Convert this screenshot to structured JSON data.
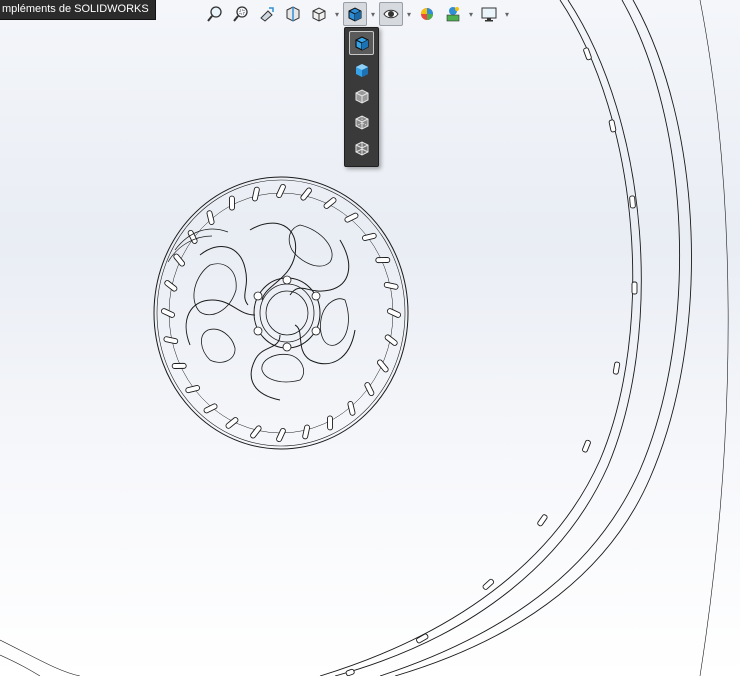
{
  "window": {
    "tab_label": "mpléments de SOLIDWORKS"
  },
  "heads_up_toolbar": {
    "items": [
      {
        "icon": "zoom-to-fit-icon"
      },
      {
        "icon": "zoom-to-area-icon"
      },
      {
        "icon": "previous-view-icon"
      },
      {
        "icon": "section-view-icon"
      },
      {
        "icon": "view-orientation-icon"
      },
      {
        "icon": "display-style-icon",
        "active": true
      },
      {
        "icon": "hide-show-items-icon"
      },
      {
        "icon": "edit-appearance-icon"
      },
      {
        "icon": "apply-scene-icon"
      },
      {
        "icon": "view-settings-icon"
      }
    ]
  },
  "display_style_flyout": {
    "items": [
      {
        "icon": "shaded-with-edges-icon",
        "selected": true
      },
      {
        "icon": "shaded-icon"
      },
      {
        "icon": "hidden-lines-removed-icon"
      },
      {
        "icon": "hidden-lines-visible-icon"
      },
      {
        "icon": "wireframe-icon"
      }
    ]
  },
  "colors": {
    "accent_blue": "#2e8fd6",
    "flyout_bg": "#3a3a3a",
    "edge_lines": "#1a1a1a"
  }
}
